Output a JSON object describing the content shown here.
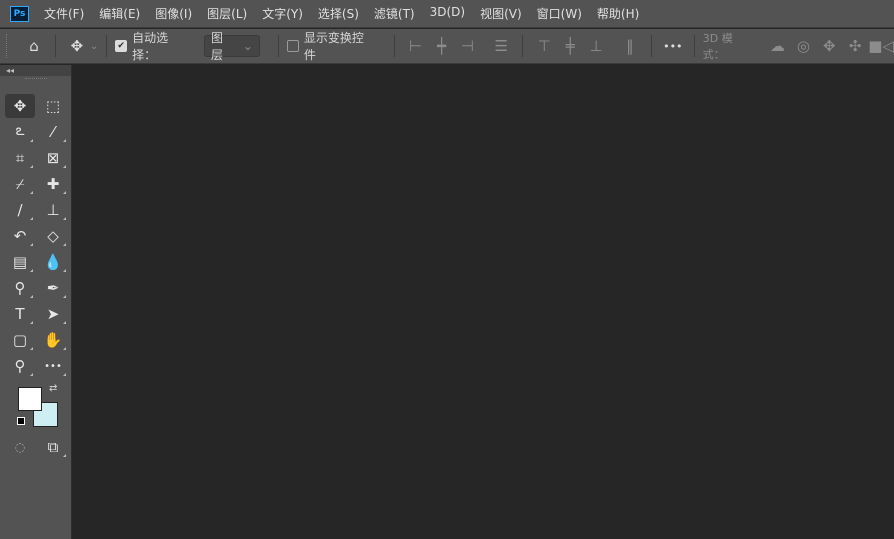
{
  "app": {
    "logo": "Ps"
  },
  "menu": [
    "文件(F)",
    "编辑(E)",
    "图像(I)",
    "图层(L)",
    "文字(Y)",
    "选择(S)",
    "滤镜(T)",
    "3D(D)",
    "视图(V)",
    "窗口(W)",
    "帮助(H)"
  ],
  "options": {
    "auto_select_label": "自动选择：",
    "auto_select_checked": true,
    "target_value": "图层",
    "show_transform_label": "显示变换控件",
    "show_transform_checked": false,
    "mode_3d_label": "3D 模式："
  },
  "colors": {
    "foreground": "#ffffff",
    "background": "#cdeef2"
  },
  "tools": [
    {
      "name": "move-tool",
      "glyph": "✥"
    },
    {
      "name": "marquee-tool",
      "glyph": "⬚"
    },
    {
      "name": "lasso-tool",
      "glyph": "ఽ"
    },
    {
      "name": "magic-wand-tool",
      "glyph": "⁄"
    },
    {
      "name": "crop-tool",
      "glyph": "⌗"
    },
    {
      "name": "frame-tool",
      "glyph": "⊠"
    },
    {
      "name": "eyedropper-tool",
      "glyph": "⌿"
    },
    {
      "name": "healing-brush-tool",
      "glyph": "✚"
    },
    {
      "name": "brush-tool",
      "glyph": "∕"
    },
    {
      "name": "clone-stamp-tool",
      "glyph": "⊥"
    },
    {
      "name": "history-brush-tool",
      "glyph": "↶"
    },
    {
      "name": "eraser-tool",
      "glyph": "◇"
    },
    {
      "name": "gradient-tool",
      "glyph": "▤"
    },
    {
      "name": "blur-tool",
      "glyph": "💧"
    },
    {
      "name": "dodge-tool",
      "glyph": "⚲"
    },
    {
      "name": "pen-tool",
      "glyph": "✒"
    },
    {
      "name": "type-tool",
      "glyph": "T"
    },
    {
      "name": "path-selection-tool",
      "glyph": "➤"
    },
    {
      "name": "rectangle-tool",
      "glyph": "▢"
    },
    {
      "name": "hand-tool",
      "glyph": "✋"
    },
    {
      "name": "zoom-tool",
      "glyph": "⚲"
    },
    {
      "name": "more-tools",
      "glyph": "•••"
    }
  ]
}
